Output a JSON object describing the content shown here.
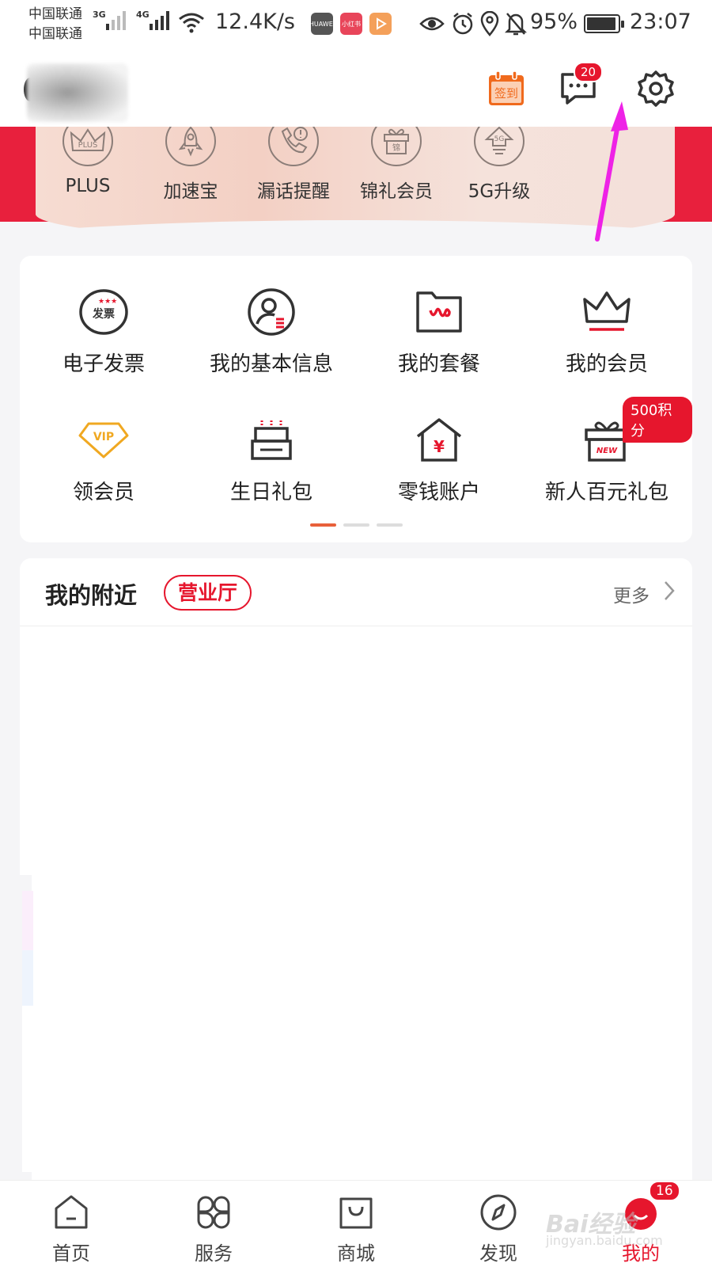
{
  "status_bar": {
    "carrier1": "中国联通",
    "carrier2": "中国联通",
    "network1": "3G",
    "network2": "4G",
    "speed": "12.4K/s",
    "app_icons": [
      "HUAWEI",
      "小红书",
      "play"
    ],
    "battery": "95%",
    "battery_level": 0.95,
    "time": "23:07"
  },
  "header": {
    "checkin_label": "签到",
    "message_badge": "20"
  },
  "banner": {
    "items": [
      {
        "label": "PLUS",
        "icon": "crown-plus-icon"
      },
      {
        "label": "加速宝",
        "icon": "rocket-icon"
      },
      {
        "label": "漏话提醒",
        "icon": "phone-alert-icon"
      },
      {
        "label": "锦礼会员",
        "icon": "gift-box-icon"
      },
      {
        "label": "5G升级",
        "icon": "5g-upgrade-icon"
      }
    ],
    "crown_text": "PLUS",
    "gift_text": "锦",
    "fiveg_text": "5G"
  },
  "grid": {
    "items": [
      {
        "label": "电子发票",
        "icon": "invoice-icon",
        "icon_text": "发票"
      },
      {
        "label": "我的基本信息",
        "icon": "profile-icon"
      },
      {
        "label": "我的套餐",
        "icon": "plan-folder-icon"
      },
      {
        "label": "我的会员",
        "icon": "crown-icon"
      },
      {
        "label": "领会员",
        "icon": "vip-diamond-icon",
        "icon_text": "VIP"
      },
      {
        "label": "生日礼包",
        "icon": "birthday-cake-icon"
      },
      {
        "label": "零钱账户",
        "icon": "wallet-house-icon",
        "icon_text": "¥"
      },
      {
        "label": "新人百元礼包",
        "icon": "new-gift-icon",
        "icon_text": "NEW"
      }
    ],
    "points_badge": "500积分",
    "page_count": 3,
    "active_page": 0
  },
  "nearby": {
    "title": "我的附近",
    "tag": "营业厅",
    "more": "更多"
  },
  "tabbar": {
    "items": [
      {
        "label": "首页",
        "icon": "home-icon"
      },
      {
        "label": "服务",
        "icon": "services-icon"
      },
      {
        "label": "商城",
        "icon": "shopping-bag-icon"
      },
      {
        "label": "发现",
        "icon": "compass-icon"
      },
      {
        "label": "我的",
        "icon": "my-icon"
      }
    ],
    "active_index": 4,
    "my_badge": "16"
  },
  "watermark": {
    "brand": "Bai经验",
    "url": "jingyan.baidu.com"
  },
  "colors": {
    "brand_red": "#e6162d",
    "annotation_arrow": "#ee22e6",
    "checkin_orange": "#f06a1d"
  }
}
